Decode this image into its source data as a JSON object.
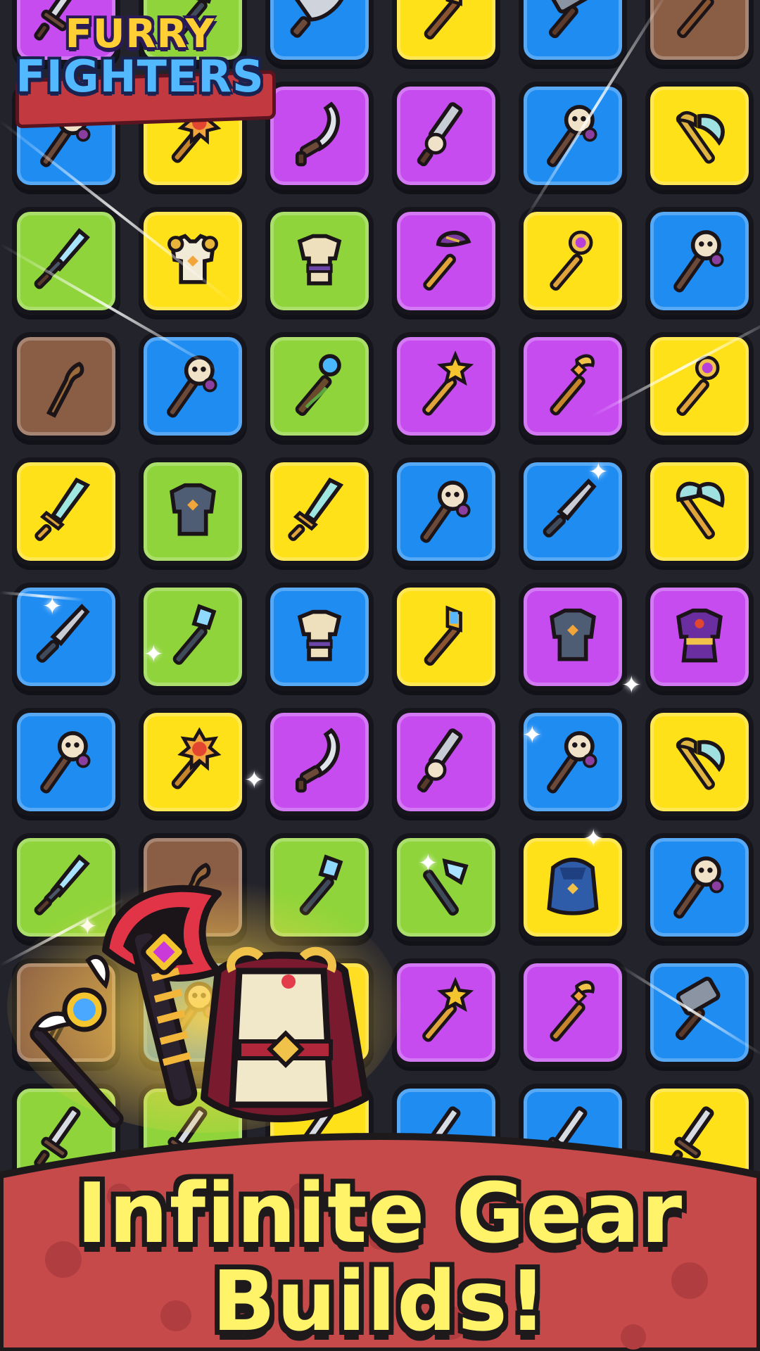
{
  "logo": {
    "line1": "FURRY",
    "line2": "FIGHTERS"
  },
  "banner": {
    "line1": "Infinite Gear",
    "line2": "Builds!"
  },
  "colors": {
    "blue": "#1f8cf2",
    "yellow": "#ffe11a",
    "purple": "#c64cf0",
    "green": "#8ed43a",
    "brown": "#8a5d45",
    "banner_red": "#c74a4a",
    "headline_yellow": "#fff36a"
  },
  "grid": {
    "rows": [
      [
        {
          "color": "purple",
          "icon": "sword-icon"
        },
        {
          "color": "green",
          "icon": "crystal-spear-icon"
        },
        {
          "color": "blue",
          "icon": "cleaver-icon"
        },
        {
          "color": "yellow",
          "icon": "gem-staff-icon"
        },
        {
          "color": "blue",
          "icon": "hammer-icon"
        },
        {
          "color": "brown",
          "icon": "leaf-staff-icon"
        }
      ],
      [
        {
          "color": "blue",
          "icon": "skull-staff-icon"
        },
        {
          "color": "yellow",
          "icon": "sun-mace-icon"
        },
        {
          "color": "purple",
          "icon": "scimitar-icon"
        },
        {
          "color": "purple",
          "icon": "skull-sword-icon"
        },
        {
          "color": "blue",
          "icon": "skull-staff-icon"
        },
        {
          "color": "yellow",
          "icon": "axe-icon"
        }
      ],
      [
        {
          "color": "green",
          "icon": "ice-blade-icon"
        },
        {
          "color": "yellow",
          "icon": "chest-armor-icon"
        },
        {
          "color": "green",
          "icon": "tunic-icon"
        },
        {
          "color": "purple",
          "icon": "mushroom-staff-icon"
        },
        {
          "color": "yellow",
          "icon": "moon-staff-icon"
        },
        {
          "color": "blue",
          "icon": "skull-staff-icon"
        }
      ],
      [
        {
          "color": "brown",
          "icon": "wooden-staff-icon"
        },
        {
          "color": "blue",
          "icon": "skull-staff-icon"
        },
        {
          "color": "green",
          "icon": "orb-staff-icon"
        },
        {
          "color": "purple",
          "icon": "star-wand-icon"
        },
        {
          "color": "purple",
          "icon": "wing-staff-icon"
        },
        {
          "color": "yellow",
          "icon": "moon-staff-icon"
        }
      ],
      [
        {
          "color": "yellow",
          "icon": "crystal-sword-icon"
        },
        {
          "color": "green",
          "icon": "plate-armor-icon"
        },
        {
          "color": "yellow",
          "icon": "crystal-sword-icon"
        },
        {
          "color": "blue",
          "icon": "skull-staff-icon"
        },
        {
          "color": "blue",
          "icon": "dagger-icon"
        },
        {
          "color": "yellow",
          "icon": "battle-axe-icon"
        }
      ],
      [
        {
          "color": "blue",
          "icon": "dagger-icon"
        },
        {
          "color": "green",
          "icon": "crystal-spear-icon"
        },
        {
          "color": "blue",
          "icon": "tunic-icon"
        },
        {
          "color": "yellow",
          "icon": "gem-staff-icon"
        },
        {
          "color": "purple",
          "icon": "plate-armor-icon"
        },
        {
          "color": "purple",
          "icon": "robe-icon"
        }
      ],
      [
        {
          "color": "blue",
          "icon": "skull-staff-icon"
        },
        {
          "color": "yellow",
          "icon": "sun-mace-icon"
        },
        {
          "color": "purple",
          "icon": "scimitar-icon"
        },
        {
          "color": "purple",
          "icon": "skull-sword-icon"
        },
        {
          "color": "blue",
          "icon": "skull-staff-icon"
        },
        {
          "color": "yellow",
          "icon": "axe-icon"
        }
      ],
      [
        {
          "color": "green",
          "icon": "ice-blade-icon"
        },
        {
          "color": "brown",
          "icon": "wooden-staff-icon"
        },
        {
          "color": "green",
          "icon": "crystal-spear-icon"
        },
        {
          "color": "green",
          "icon": "ice-axe-icon"
        },
        {
          "color": "yellow",
          "icon": "cape-icon"
        },
        {
          "color": "blue",
          "icon": "skull-staff-icon"
        }
      ],
      [
        {
          "color": "brown",
          "icon": "wooden-staff-icon"
        },
        {
          "color": "blue",
          "icon": "skull-staff-icon"
        },
        {
          "color": "yellow",
          "icon": "gem-staff-icon"
        },
        {
          "color": "purple",
          "icon": "star-wand-icon"
        },
        {
          "color": "purple",
          "icon": "wing-staff-icon"
        },
        {
          "color": "blue",
          "icon": "hammer-icon"
        }
      ],
      [
        {
          "color": "green",
          "icon": "sword-icon"
        },
        {
          "color": "green",
          "icon": "sword-icon"
        },
        {
          "color": "yellow",
          "icon": "sword-icon"
        },
        {
          "color": "blue",
          "icon": "sword-icon"
        },
        {
          "color": "blue",
          "icon": "sword-icon"
        },
        {
          "color": "yellow",
          "icon": "sword-icon"
        }
      ]
    ]
  },
  "featured": {
    "items": [
      "winged-orb-staff-icon",
      "red-battle-axe-icon",
      "royal-armor-icon"
    ]
  }
}
